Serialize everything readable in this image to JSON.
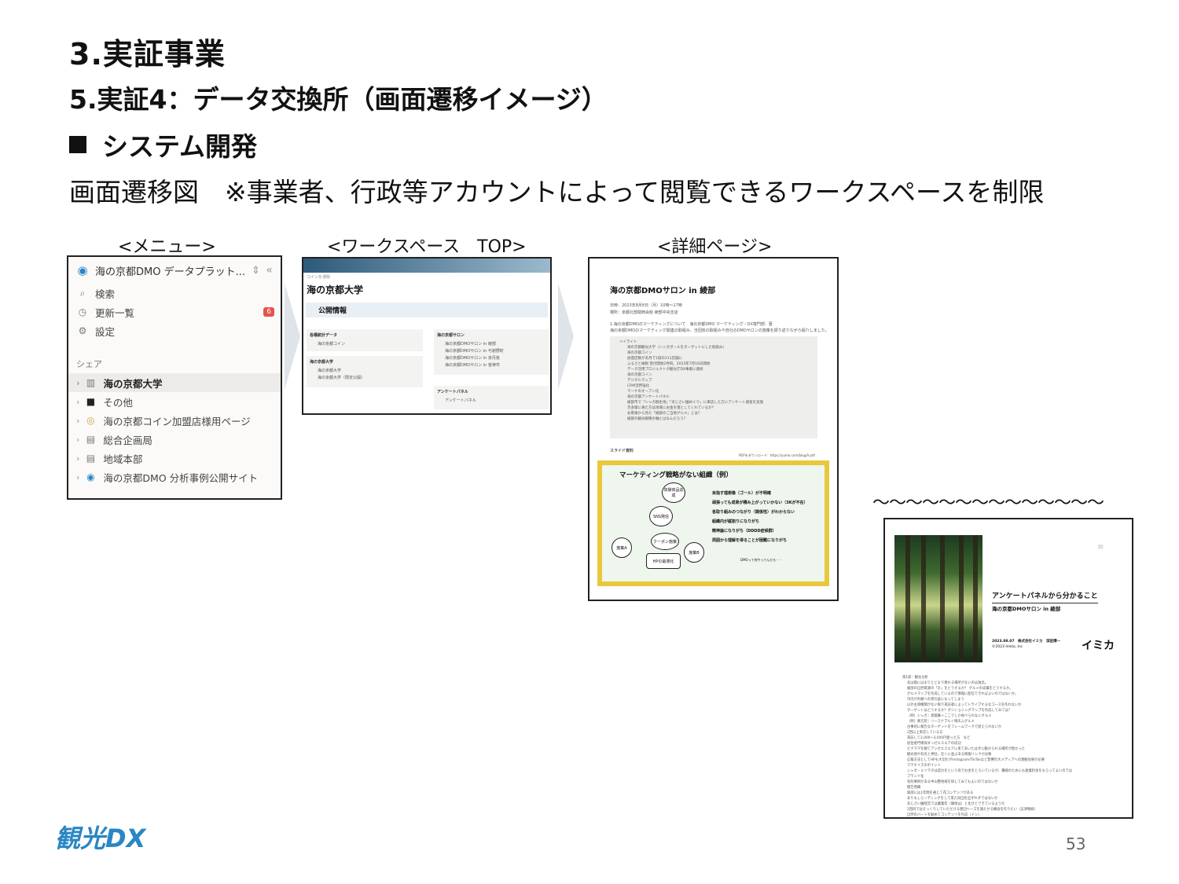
{
  "heading": {
    "title": "3.実証事業",
    "subtitle": "5.実証4：データ交換所（画面遷移イメージ）",
    "section": "システム開発",
    "caption": "画面遷移図　※事業者、行政等アカウントによって閲覧できるワークスペースを制限"
  },
  "labels": {
    "menu": "<メニュー>",
    "workspace": "<ワークスペース　TOP>",
    "detail": "<詳細ページ>",
    "tilde": "〜〜〜〜〜〜〜〜〜〜〜〜〜〜"
  },
  "menu": {
    "workspace_name": "海の京都DMO データプラット...",
    "search": "検索",
    "updates": "更新一覧",
    "updates_badge": "6",
    "settings": "設定",
    "share_header": "シェア",
    "items": [
      "海の京都大学",
      "その他",
      "海の京都コイン加盟店様用ページ",
      "総合企画局",
      "地域本部",
      "海の京都DMO 分析事例公開サイト"
    ]
  },
  "workspace": {
    "breadcrumb": "コインを通販",
    "title": "海の京都大学",
    "public": "公開情報",
    "card1_title": "各種統計データ",
    "card1_items": [
      "海の京都コイン"
    ],
    "card2_title": "海の京都大学",
    "card2_items": [
      "海の京都大学",
      "海の京都大学（限定公開）"
    ],
    "card3_title": "海の京都サロン",
    "card3_items": [
      "海の京都DMOサロン in 綾部",
      "海の京都DMOサロン in 与謝野町",
      "海の京都DMOサロン in 京丹後",
      "海の京都DMOサロン in 宮津市"
    ],
    "card4_title": "アンケートパネル",
    "card4_items": [
      "アンケートパネル"
    ]
  },
  "detail": {
    "title": "海の京都DMOサロン in 綾部",
    "date": "日時：2023年8月8日（月）10時〜17時",
    "place": "場所：京都北部関西会館 綾部中央支店",
    "lead": "1.海の京都DMOのマーケティングについて　海の京都DMO マーケティング・DX専門部：晋",
    "lead2": "海の京都DMOのマーケティング関連の取組み、当団体の取組みや自社のDMOサロンの施策を振り返りながら紹介しました。",
    "box_lines": [
      "ハイライト",
      "海の京都観光大学（シニガポールをターゲットにした取組み）",
      "海の京都コイン",
      "加盟店数があ月で1倍の211店舗に",
      "ふるさと納税 受付開始2件目。2023年7月16日開始",
      "データ活用プロジェクトが観光庁DX事業に選択",
      "海の京都コイン",
      "デジタルマップ",
      "CRM活用強化",
      "マーケのオープン化",
      "海の京都アンケートパネル",
      "綾部市で「シャガ群生地」「あじさい園めぐり」に来訪した方にアンケート調査を実施",
      "京多摩に来た方は地域にお金を落としてくれているか？",
      "お客様から見た「綾部のご当地グルメ」とは？",
      "綾部の観光戦略の軸とはなんだろう？"
    ],
    "slide_label": "スライド資料",
    "slide_url": "PDFをダウンロード：https://yumo.com/blog/A.pdf",
    "slide_title": "マーケティング戦略がない組織（例）",
    "bullets": [
      "目指す理想像（ゴール）が不明確",
      "頑張っても成果が積み上がっていかない（3Kが不在）",
      "各取り組みのつながり（関係性）がわからない",
      "組織内が縦割りになりがち",
      "精神論になりがち（DDDD症候群）",
      "周囲から理解を得ることが困難になりがち"
    ],
    "bubbles": [
      "体験商品造成",
      "SNS発信",
      "クーポン施策",
      "HPの最適化",
      "施策A",
      "施策B"
    ],
    "speech": "DMOって何やってんだろ・・"
  },
  "survey": {
    "title": "アンケートパネルから分かること",
    "subtitle": "海の京都DMOサロン in 綾部",
    "date": "2023.08.07　株式会社イミカ　深田博一",
    "copy": "©2023 Imika, Inc",
    "logo": "イミカ",
    "lines": [
      "第1部：観光分析",
      "北は陵にはまりとどまり異れる場所がないのは独念。",
      "綾部の自然資源の「京」をどうするか？ グルメの成績をどうするか。",
      "グルメマップを作成しているので情報に配信できればよいのではないか。",
      "市内が外観への導引庭になってしまう",
      "以外主導機関がない限り来訪者によってトライブするなコースを作れないか",
      "ターゲットはどうするか？ポジショニングマップを作成してみては？",
      "（例）シャガ｜黒鍛錬＋ここでしか食べられないグルメ",
      "（例）栗元院｜リースナブル＋晴天ふグルメ",
      "古事的に報告なターゲットをフレームワークで捉えられないか",
      "2回以上来店している方",
      "来訪して2,000〜3,000円使った方　など",
      "居住者門場保ダッゼエスエアの成功",
      "ビクママを頼てアンゼエスエアに来てあいたはずに動かられる場所が無かった",
      "観光地や有名と神社、近くに並ぶある情報リンクが必要",
      "広報方法としてHPも大切だがInstagram/TikTokなど影響の大メディアへの連動効果が必要",
      "ママチイズのポイント",
      "シャガ・ミツマタは認力をという形でお金をとろいているが、種様のためにも連業料金をもらってよいのでは",
      "ブランド化",
      "有的事例がある中山整地域を探してみてもよいのではないか",
      "開告明細",
      "綾部には1年間を通じて花コンテンツがある",
      "ありもしらーディングをして来た同団を出ずれずではないか",
      "あじさい園経営では農業年（職地は）と化せとできているようだ",
      "2回目ではそっくりしていただける建団へ一ズを調たせる機会を作りたい（志津物峡）",
      "自然のバートを勧めてコンテンツを作成（ドン）"
    ]
  },
  "footer": {
    "logo": "観光DX",
    "page": "53"
  }
}
